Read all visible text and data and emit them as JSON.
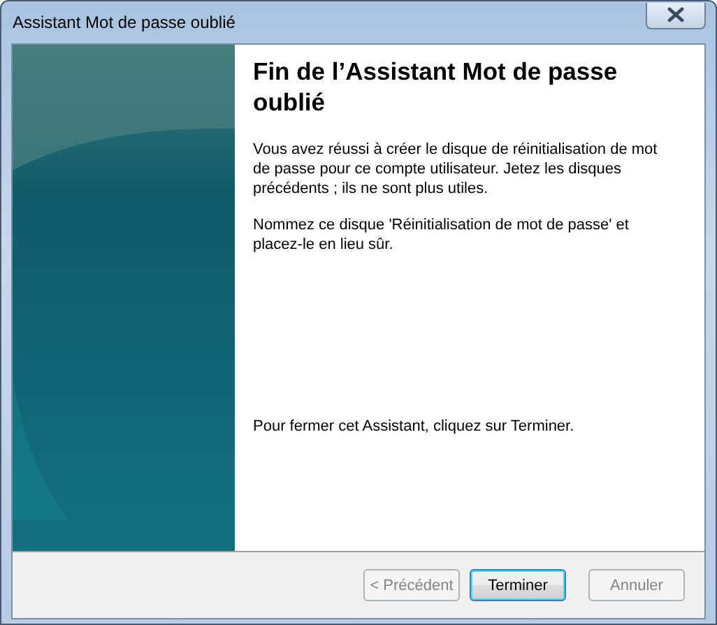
{
  "window": {
    "title": "Assistant Mot de passe oublié"
  },
  "page": {
    "heading": "Fin de l’Assistant Mot de passe oublié",
    "paragraphs": [
      "Vous avez réussi à créer le disque de réinitialisation de mot de passe pour ce compte utilisateur. Jetez les disques précédents ; ils ne sont plus utiles.",
      "Nommez ce disque 'Réinitialisation de mot de passe' et placez-le en lieu sûr."
    ],
    "footer_note": "Pour fermer cet Assistant, cliquez sur Terminer."
  },
  "buttons": [
    {
      "label": "< Précédent",
      "disabled": true,
      "default": false
    },
    {
      "label": "Terminer",
      "disabled": false,
      "default": true
    },
    {
      "label": "Annuler",
      "disabled": true,
      "default": false
    }
  ]
}
